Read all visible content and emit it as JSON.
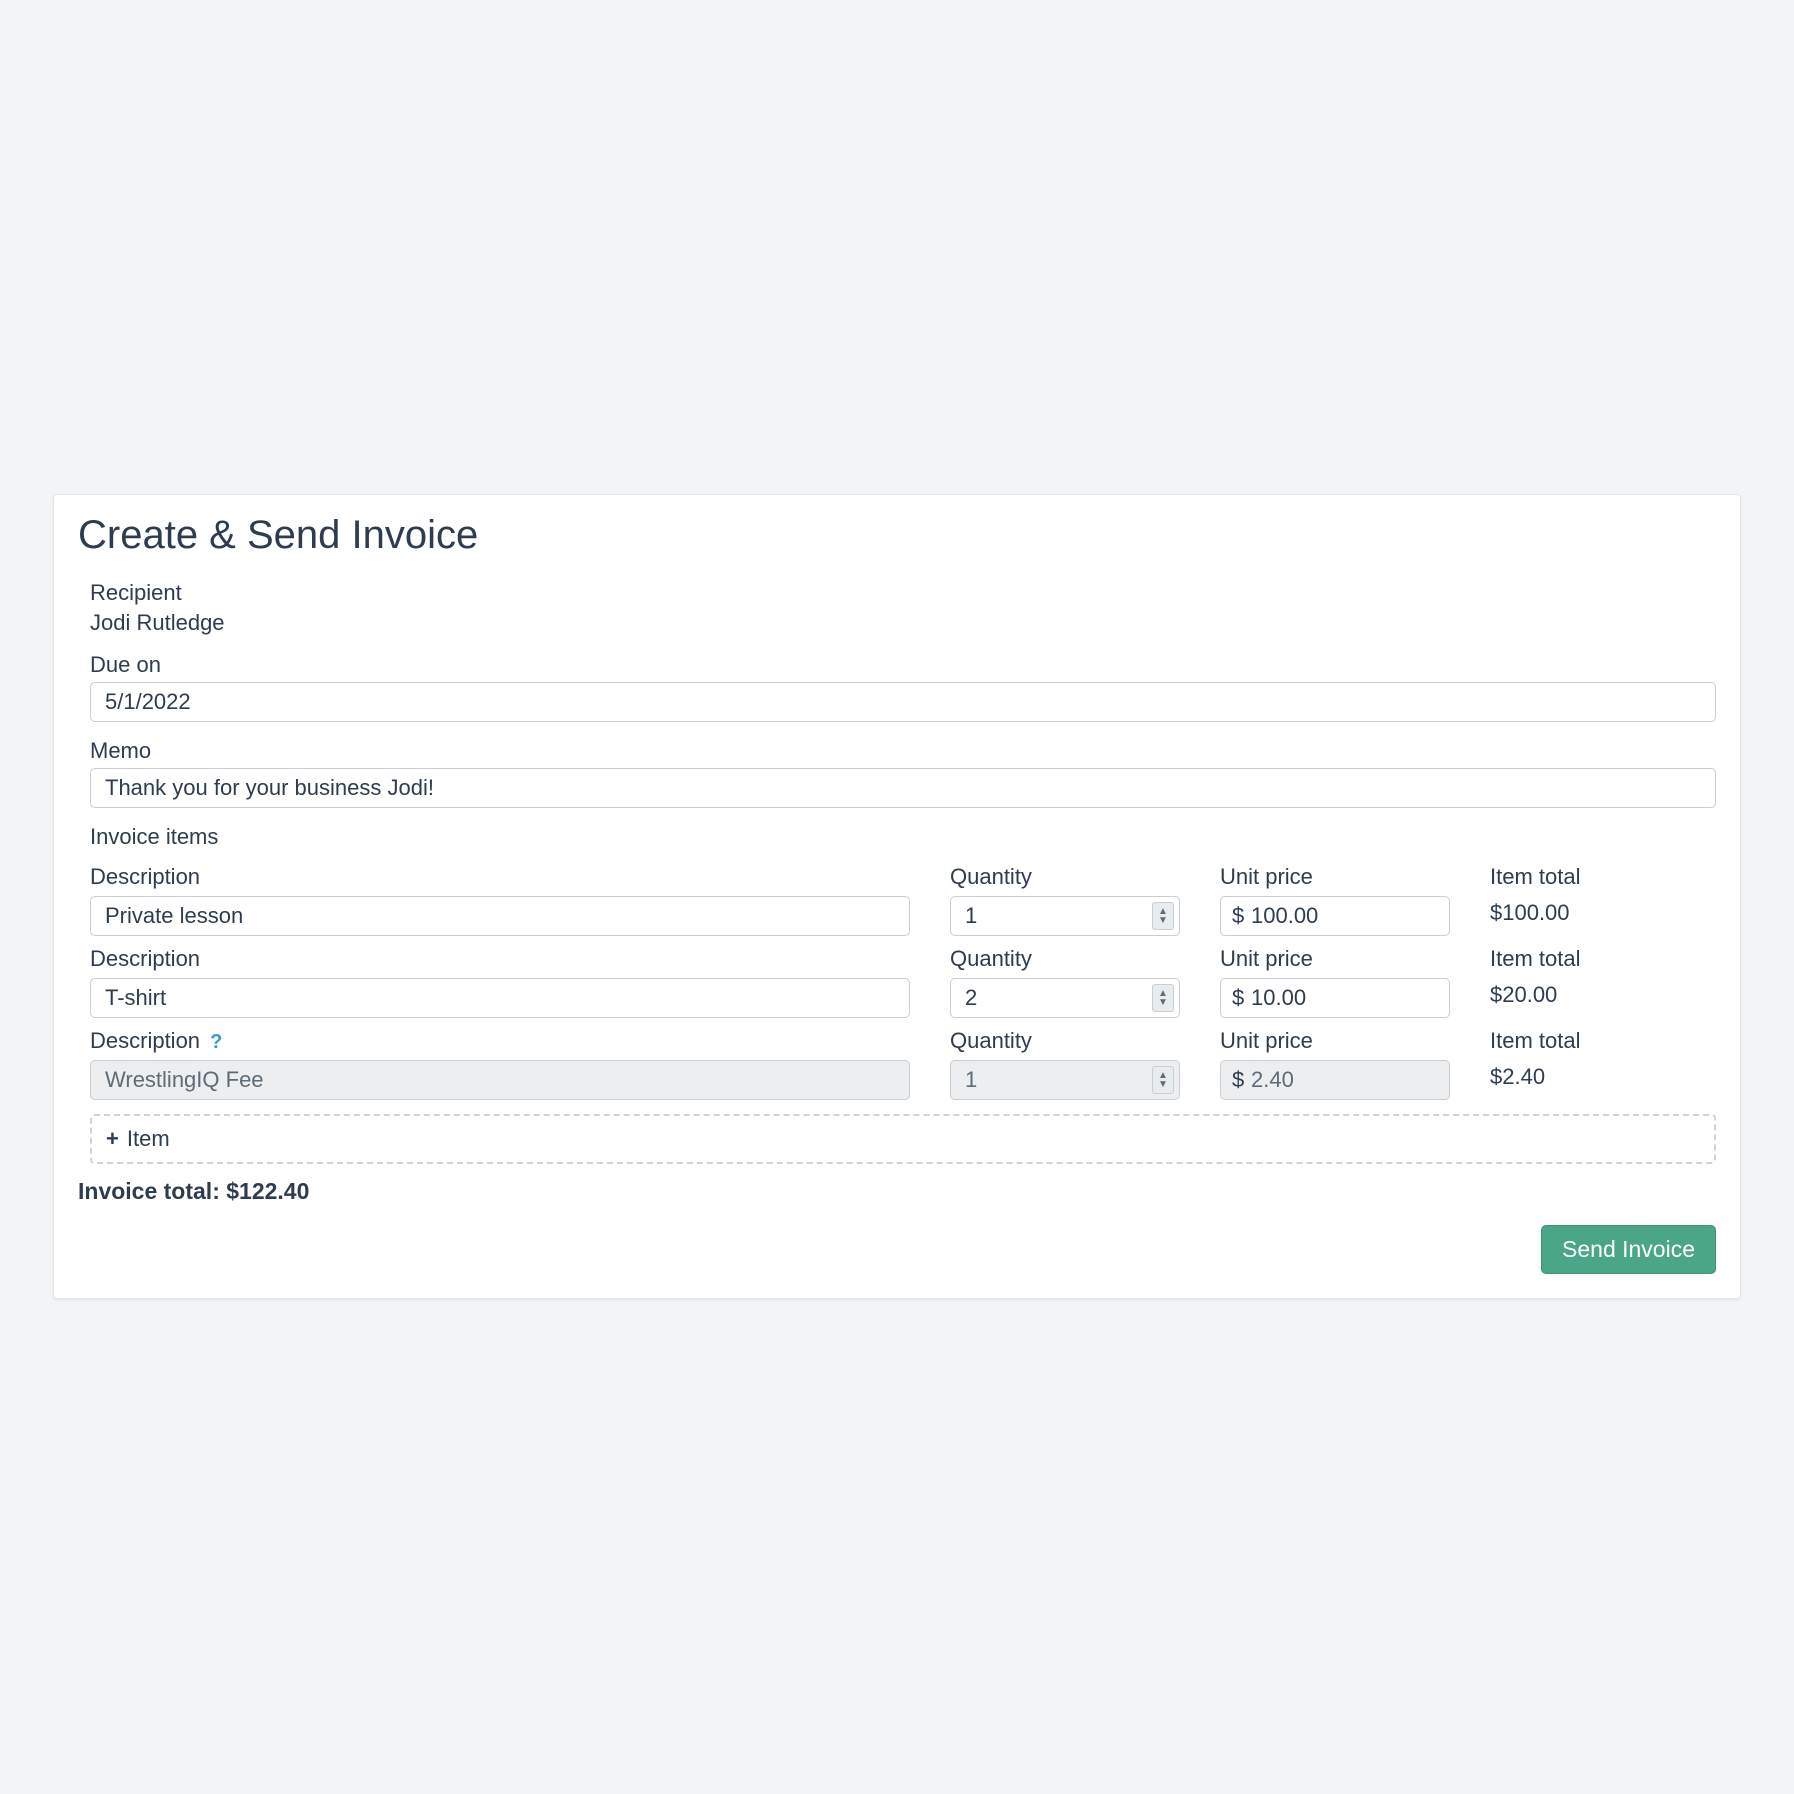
{
  "page": {
    "title": "Create & Send Invoice"
  },
  "labels": {
    "recipient": "Recipient",
    "due_on": "Due on",
    "memo": "Memo",
    "invoice_items": "Invoice items",
    "description": "Description",
    "quantity": "Quantity",
    "unit_price": "Unit price",
    "item_total": "Item total",
    "add_item": "Item",
    "invoice_total_prefix": "Invoice total: ",
    "send_invoice": "Send Invoice",
    "help_char": "?",
    "currency_symbol": "$"
  },
  "recipient": {
    "name": "Jodi Rutledge"
  },
  "due_on": "5/1/2022",
  "memo": "Thank you for your business Jodi!",
  "items": [
    {
      "description": "Private lesson",
      "quantity": "1",
      "unit_price": "100.00",
      "item_total": "$100.00",
      "readonly": false,
      "help": false
    },
    {
      "description": "T-shirt",
      "quantity": "2",
      "unit_price": "10.00",
      "item_total": "$20.00",
      "readonly": false,
      "help": false
    },
    {
      "description": "WrestlingIQ Fee",
      "quantity": "1",
      "unit_price": "2.40",
      "item_total": "$2.40",
      "readonly": true,
      "help": true
    }
  ],
  "invoice_total": "$122.40"
}
